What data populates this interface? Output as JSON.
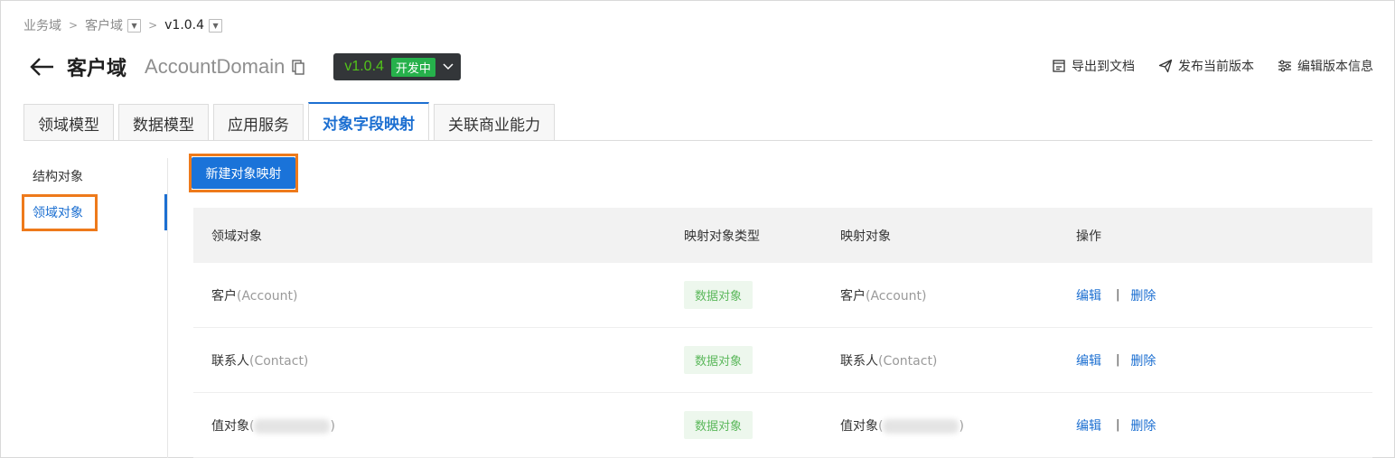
{
  "breadcrumb": {
    "items": [
      "业务域",
      "客户域",
      "v1.0.4"
    ]
  },
  "header": {
    "title_cn": "客户域",
    "title_en": "AccountDomain",
    "version": "v1.0.4",
    "status": "开发中"
  },
  "actions": {
    "export": "导出到文档",
    "publish": "发布当前版本",
    "edit_version": "编辑版本信息"
  },
  "tabs": [
    {
      "label": "领域模型",
      "active": false
    },
    {
      "label": "数据模型",
      "active": false
    },
    {
      "label": "应用服务",
      "active": false
    },
    {
      "label": "对象字段映射",
      "active": true
    },
    {
      "label": "关联商业能力",
      "active": false
    }
  ],
  "sidebar": {
    "items": [
      {
        "label": "结构对象",
        "active": false
      },
      {
        "label": "领域对象",
        "active": true
      }
    ]
  },
  "new_mapping_button": "新建对象映射",
  "table": {
    "headers": [
      "领域对象",
      "映射对象类型",
      "映射对象",
      "操作"
    ],
    "rows": [
      {
        "domain_cn": "客户",
        "domain_en": "(Account)",
        "type": "数据对象",
        "mapped_cn": "客户",
        "mapped_en": "(Account)",
        "edit": "编辑",
        "delete": "删除"
      },
      {
        "domain_cn": "联系人",
        "domain_en": "(Contact)",
        "type": "数据对象",
        "mapped_cn": "联系人",
        "mapped_en": "(Contact)",
        "edit": "编辑",
        "delete": "删除"
      },
      {
        "domain_cn": "值对象",
        "domain_en_open": "(",
        "domain_en_close": ")",
        "type": "数据对象",
        "mapped_cn": "值对象",
        "mapped_en_open": "(",
        "mapped_en_close": ")",
        "edit": "编辑",
        "delete": "删除"
      }
    ],
    "op_separator": "|"
  },
  "colors": {
    "accent": "#1c6fd1",
    "highlight": "#ee7a1b",
    "status_green": "#26b14b",
    "type_tag_text": "#5cb85c"
  }
}
